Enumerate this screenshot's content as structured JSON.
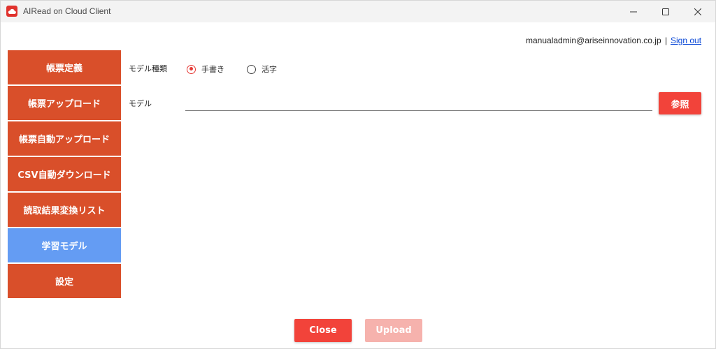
{
  "window": {
    "title": "AIRead on Cloud Client"
  },
  "account": {
    "email": "manualadmin@ariseinnovation.co.jp",
    "separator": "|",
    "sign_out": "Sign out"
  },
  "sidebar": {
    "items": [
      {
        "label": "帳票定義",
        "active": false
      },
      {
        "label": "帳票アップロード",
        "active": false
      },
      {
        "label": "帳票自動アップロード",
        "active": false
      },
      {
        "label": "CSV自動ダウンロード",
        "active": false
      },
      {
        "label": "読取結果変換リスト",
        "active": false
      },
      {
        "label": "学習モデル",
        "active": true
      },
      {
        "label": "設定",
        "active": false
      }
    ]
  },
  "form": {
    "model_type_label": "モデル種類",
    "radio_options": [
      {
        "label": "手書き",
        "checked": true
      },
      {
        "label": "活字",
        "checked": false
      }
    ],
    "model_label": "モデル",
    "model_value": "",
    "browse_label": "参照"
  },
  "footer": {
    "close_label": "Close",
    "upload_label": "Upload"
  },
  "colors": {
    "nav_bg": "#d94f2a",
    "nav_active_bg": "#649cf3",
    "primary_button": "#f2433a",
    "disabled_button": "#f6b2ad",
    "radio_checked": "#e53935"
  }
}
